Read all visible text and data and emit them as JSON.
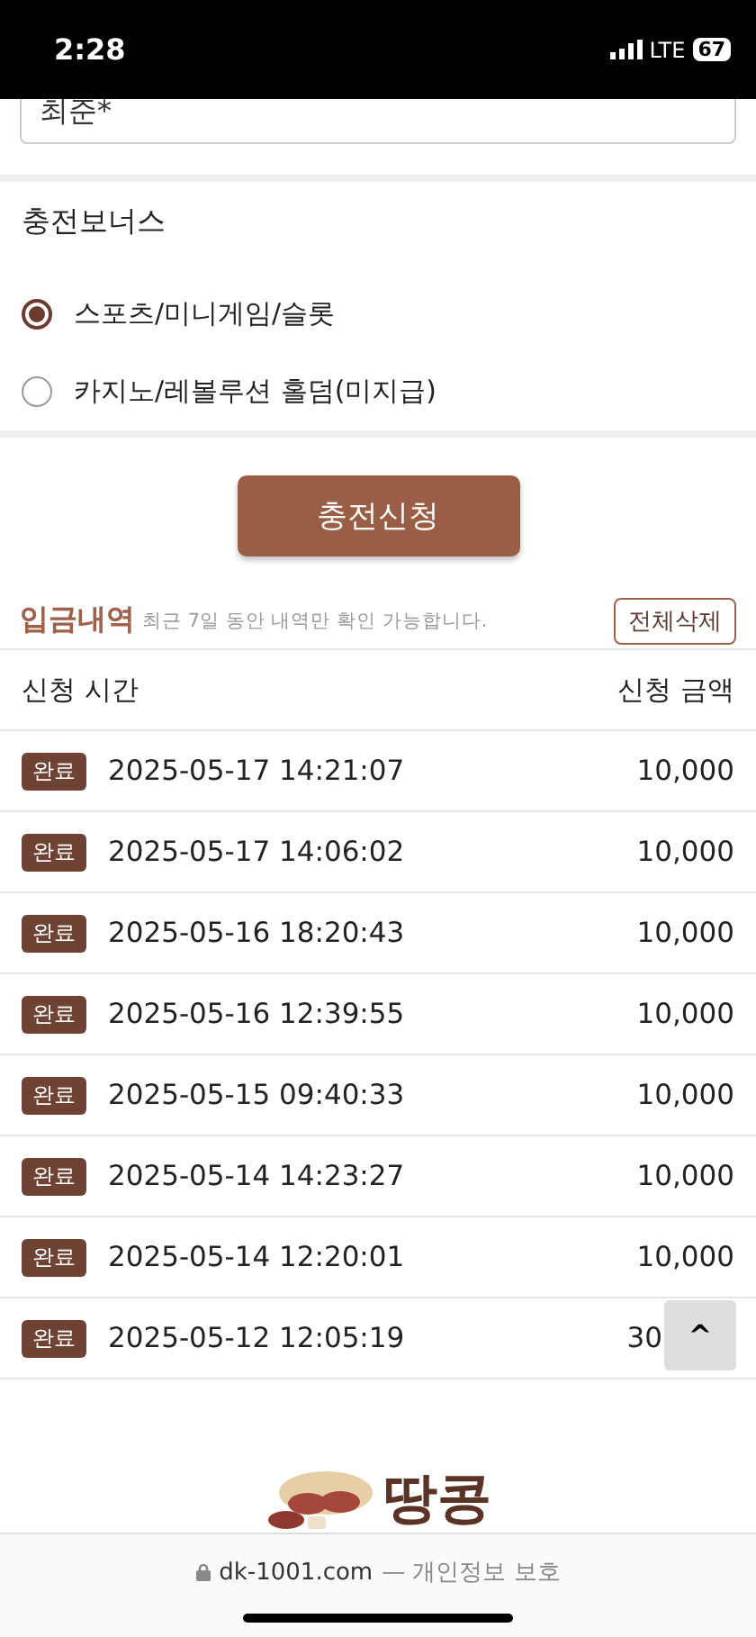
{
  "status_bar": {
    "time": "2:28",
    "network": "LTE",
    "battery": "67"
  },
  "name_field": {
    "value": "최준*"
  },
  "bonus": {
    "title": "충전보너스",
    "options": [
      {
        "label": "스포츠/미니게임/슬롯",
        "selected": true
      },
      {
        "label": "카지노/레볼루션 홀덤(미지급)",
        "selected": false
      }
    ]
  },
  "submit_button": "충전신청",
  "history": {
    "title": "입금내역",
    "note": "최근 7일 동안 내역만 확인 가능합니다.",
    "delete_button": "전체삭제",
    "columns": [
      "신청 시간",
      "신청 금액"
    ],
    "rows": [
      {
        "status": "완료",
        "time": "2025-05-17 14:21:07",
        "amount": "10,000"
      },
      {
        "status": "완료",
        "time": "2025-05-17 14:06:02",
        "amount": "10,000"
      },
      {
        "status": "완료",
        "time": "2025-05-16 18:20:43",
        "amount": "10,000"
      },
      {
        "status": "완료",
        "time": "2025-05-16 12:39:55",
        "amount": "10,000"
      },
      {
        "status": "완료",
        "time": "2025-05-15 09:40:33",
        "amount": "10,000"
      },
      {
        "status": "완료",
        "time": "2025-05-14 14:23:27",
        "amount": "10,000"
      },
      {
        "status": "완료",
        "time": "2025-05-14 12:20:01",
        "amount": "10,000"
      },
      {
        "status": "완료",
        "time": "2025-05-12 12:05:19",
        "amount": "30"
      }
    ]
  },
  "scroll_top_button": "^",
  "logo": {
    "text": "땅콩"
  },
  "url_bar": {
    "domain": "dk-1001.com",
    "suffix": "— 개인정보 보호"
  }
}
